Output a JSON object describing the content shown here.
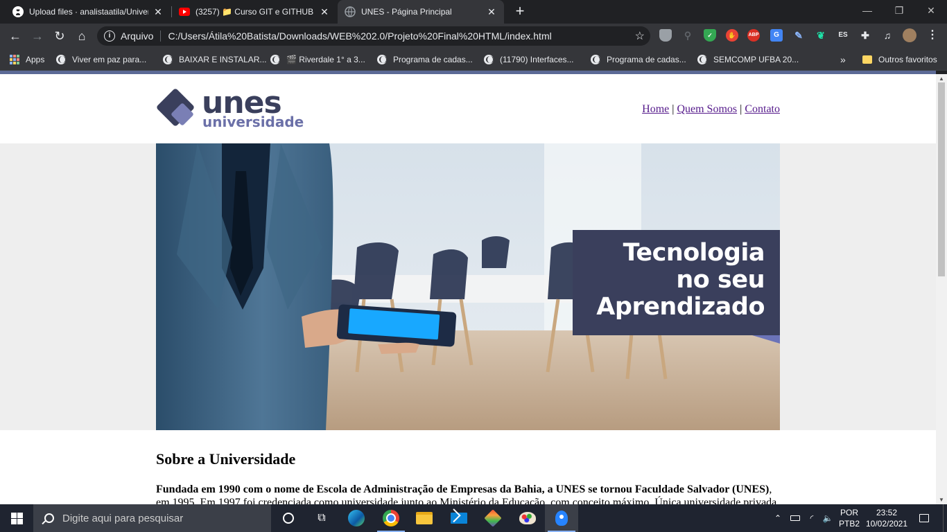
{
  "browser": {
    "tabs": [
      {
        "title": "Upload files · analistaatila/Univer",
        "favicon": "github-icon",
        "active": false
      },
      {
        "title": "(3257) 📁 Curso GIT e GITHUB - ",
        "favicon": "youtube-icon",
        "active": false
      },
      {
        "title": "UNES - Página Principal",
        "favicon": "globe-icon",
        "active": true
      }
    ],
    "address": {
      "label": "Arquivo",
      "url": "C:/Users/Átila%20Batista/Downloads/WEB%202.0/Projeto%20Final%20HTML/index.html"
    },
    "extensions": [
      "shield-icon",
      "key-icon",
      "adguard-icon",
      "stop-icon",
      "adblock-plus-icon",
      "translate-icon",
      "pen-icon",
      "feather-icon",
      "language-icon",
      "puzzle-icon",
      "media-icon",
      "profile-avatar"
    ],
    "extension_texts": {
      "abp": "ABP",
      "lang": "ES"
    },
    "bookmarks": [
      {
        "label": "Apps",
        "icon": "apps-icon"
      },
      {
        "label": "Viver em paz para...",
        "icon": "globe-icon"
      },
      {
        "label": "BAIXAR E INSTALAR...",
        "icon": "globe-icon"
      },
      {
        "label": "🎬 Riverdale 1° a 3...",
        "icon": "globe-icon"
      },
      {
        "label": "Programa de cadas...",
        "icon": "globe-icon"
      },
      {
        "label": "(11790) Interfaces...",
        "icon": "globe-icon"
      },
      {
        "label": "Programa de cadas...",
        "icon": "globe-icon"
      },
      {
        "label": "SEMCOMP UFBA 20...",
        "icon": "globe-icon"
      }
    ],
    "bookmarks_overflow": "»",
    "other_bookmarks": "Outros favoritos"
  },
  "page": {
    "logo": {
      "word": "unes",
      "sub": "universidade"
    },
    "nav": {
      "home": "Home",
      "sep": "|",
      "about": "Quem Somos",
      "contact": "Contato"
    },
    "hero": {
      "line1": "Tecnologia",
      "line2": "no seu",
      "line3": "Aprendizado"
    },
    "section_title": "Sobre a Universidade",
    "paragraph_bold": "Fundada em 1990 com o nome de Escola de Administração de Empresas da Bahia, a UNES se tornou Faculdade Salvador (UNES)",
    "paragraph_rest": ", em 1995. Em 1997 foi credenciada como universidade junto ao Ministério da Educação, com conceito máximo. Única universidade privada"
  },
  "taskbar": {
    "search_placeholder": "Digite aqui para pesquisar",
    "apps": [
      "cortana-icon",
      "task-view-icon",
      "edge-icon",
      "chrome-icon",
      "file-explorer-icon",
      "mail-icon",
      "git-icon",
      "paint-icon",
      "sourcetree-icon"
    ],
    "lang_top": "POR",
    "lang_bottom": "PTB2",
    "time": "23:52",
    "date": "10/02/2021"
  },
  "colors": {
    "brand_dark": "#3a3f5c",
    "brand_light": "#6b70a8",
    "accent": "#5c6a96"
  }
}
